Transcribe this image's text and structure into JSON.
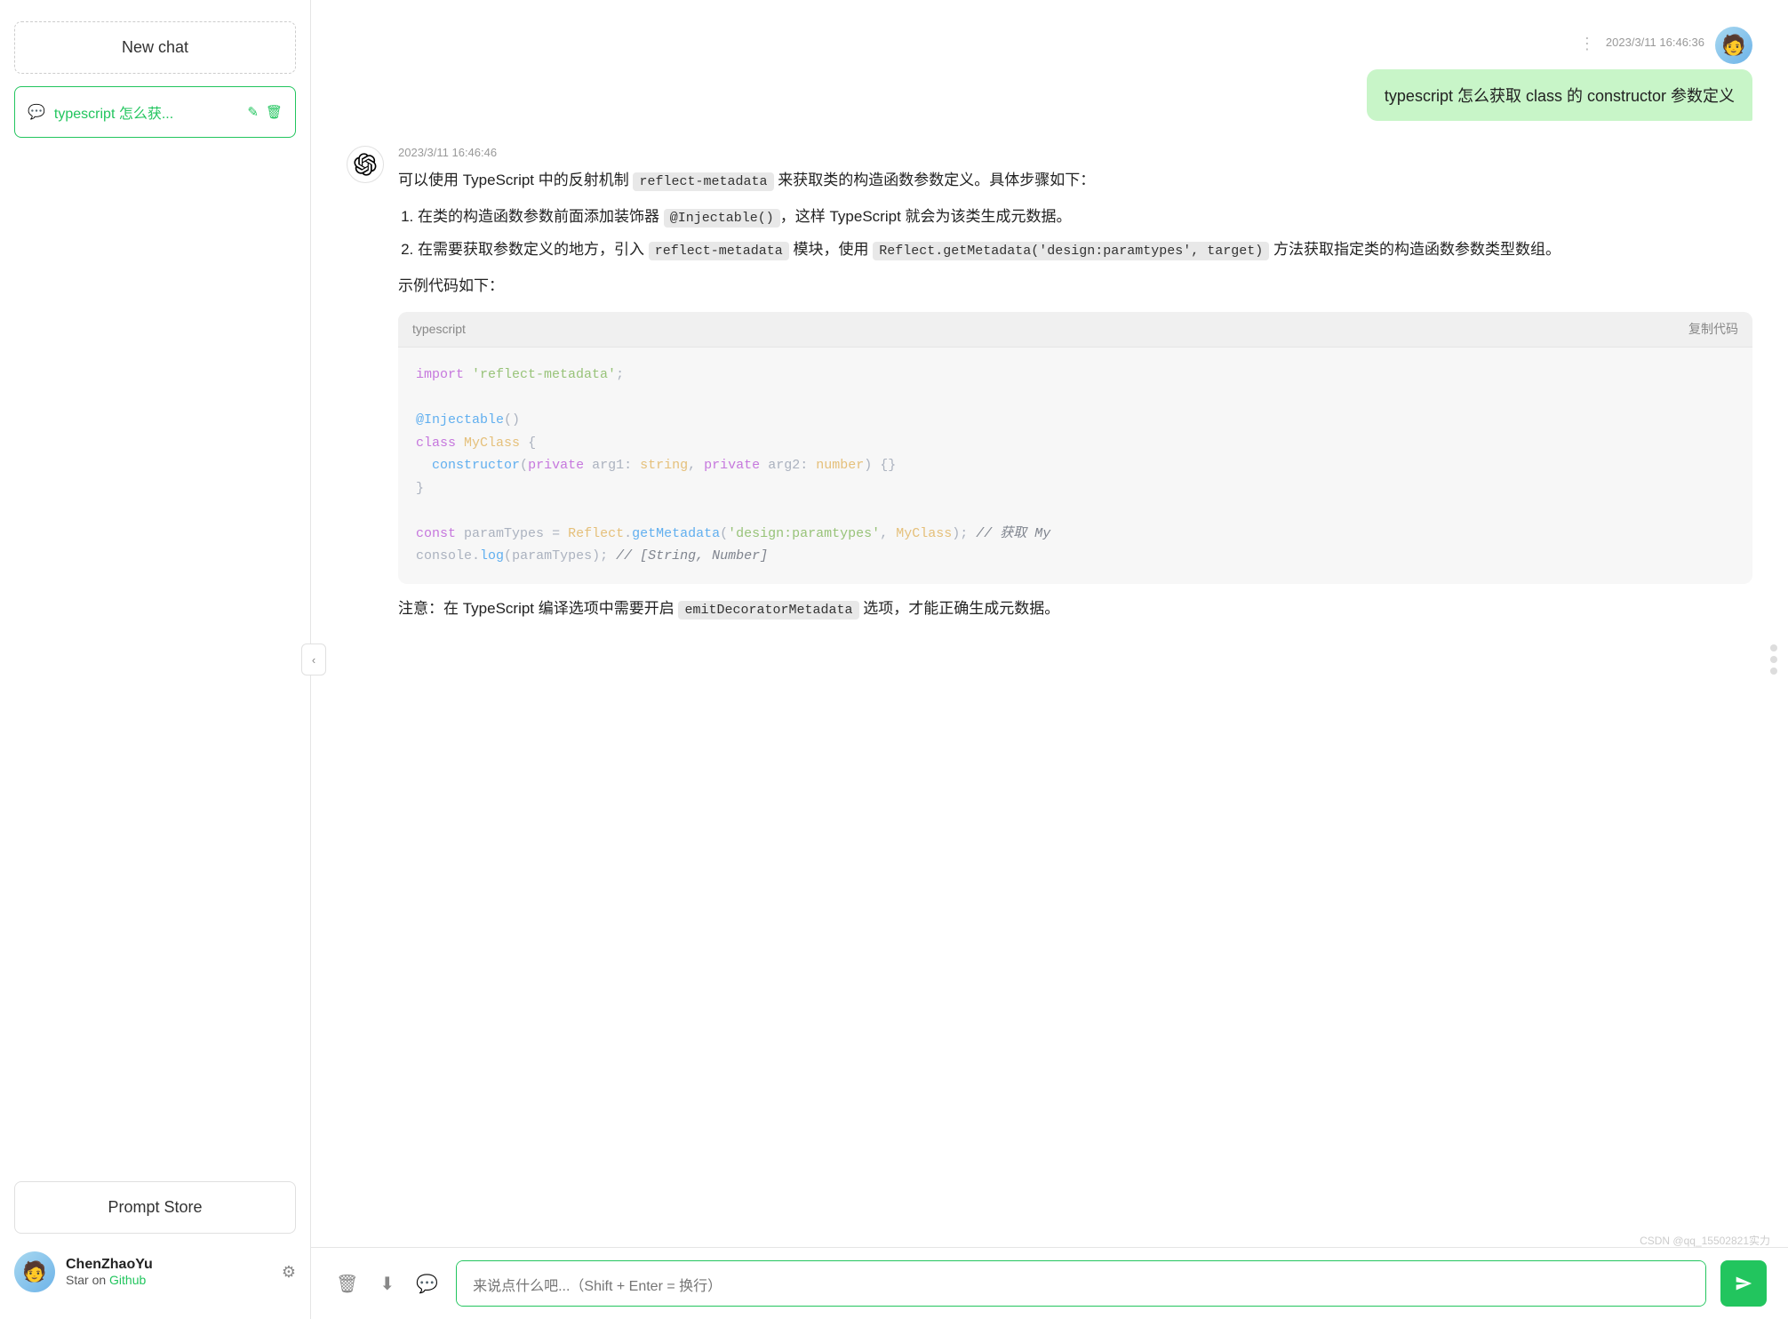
{
  "sidebar": {
    "new_chat_label": "New chat",
    "chat_items": [
      {
        "id": "chat-1",
        "icon": "💬",
        "title": "typescript 怎么获...",
        "full_title": "typescript 怎么获取 class 的 constructor 参数定义"
      }
    ],
    "prompt_store_label": "Prompt Store",
    "user": {
      "name": "ChenZhaoYu",
      "sub_text": "Star on ",
      "sub_link": "Github",
      "sub_link_url": "#"
    }
  },
  "chat": {
    "messages": [
      {
        "type": "user",
        "timestamp": "2023/3/11 16:46:36",
        "content": "typescript 怎么获取 class 的 constructor 参数定义"
      },
      {
        "type": "ai",
        "timestamp": "2023/3/11 16:46:46",
        "intro": "可以使用 TypeScript 中的反射机制 reflect-metadata 来获取类的构造函数参数定义。具体步骤如下：",
        "steps": [
          "在类的构造函数参数前面添加装饰器 @Injectable()，这样 TypeScript 就会为该类生成元数据。",
          "在需要获取参数定义的地方，引入 reflect-metadata 模块，使用 Reflect.getMetadata('design:paramtypes', target) 方法获取指定类的构造函数参数类型数组。"
        ],
        "example_intro": "示例代码如下：",
        "code_lang": "typescript",
        "copy_label": "复制代码",
        "note": "注意：在 TypeScript 编译选项中需要开启 emitDecoratorMetadata 选项，才能正确生成元数据。"
      }
    ]
  },
  "input": {
    "placeholder": "来说点什么吧...（Shift + Enter = 换行）"
  },
  "watermark": "CSDN @qq_15502821实力",
  "icons": {
    "collapse": "‹",
    "edit": "✎",
    "delete": "🗑",
    "delete_btn": "🗑",
    "download": "⬇",
    "chat_msg": "💬",
    "settings": "⚙",
    "send": "➤"
  }
}
